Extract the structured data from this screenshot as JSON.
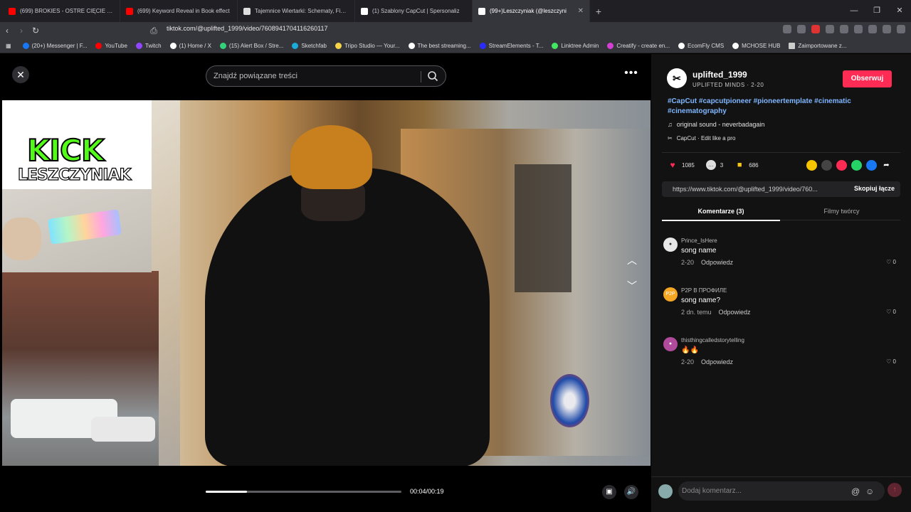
{
  "tabs": [
    {
      "label": "(699) BROKIES - OSTRE CIĘCIE - Y",
      "color": "#ff0000"
    },
    {
      "label": "(699) Keyword Reveal in Book effect",
      "color": "#ff0000"
    },
    {
      "label": "Tajemnice Wiertarki: Schematy, Fizyk",
      "color": "#ffffff"
    },
    {
      "label": "(1) Szablony CapCut | Spersonaliz",
      "color": "#ffffff"
    },
    {
      "label": "(99+)Leszczyniak (@leszczyni",
      "color": "#ffffff"
    }
  ],
  "url": "tiktok.com/@uplifted_1999/video/7608941704116260117",
  "bookmarks": [
    {
      "label": "(20+) Messenger | F...",
      "color": "#1877f2"
    },
    {
      "label": "YouTube",
      "color": "#ff0000"
    },
    {
      "label": "Twitch",
      "color": "#9146ff"
    },
    {
      "label": "(1) Home / X",
      "color": "#ffffff"
    },
    {
      "label": "(15) Alert Box / Stre...",
      "color": "#33d17a"
    },
    {
      "label": "Sketchfab",
      "color": "#1caad9"
    },
    {
      "label": "Tripo Studio — Your...",
      "color": "#f5d547"
    },
    {
      "label": "The best streaming...",
      "color": "#ffffff"
    },
    {
      "label": "StreamElements - T...",
      "color": "#2b2bff"
    },
    {
      "label": "Linktree Admin",
      "color": "#43e660"
    },
    {
      "label": "Creatify - create en...",
      "color": "#d43fd4"
    },
    {
      "label": "EcomFly CMS",
      "color": "#ffffff"
    },
    {
      "label": "MCHOSE HUB",
      "color": "#ffffff"
    },
    {
      "label": "Zaimportowane z...",
      "color": "#cccccc"
    }
  ],
  "video": {
    "search_placeholder": "Znajdź powiązane treści",
    "overlay_kick": "KICK",
    "overlay_name": "LESZCZYNIAK",
    "time": "00:04/00:19",
    "progress_fraction": 0.21
  },
  "panel": {
    "username": "uplifted_1999",
    "subline": "UPLIFTED MINDS · 2-20",
    "follow_label": "Obserwuj",
    "hashtags": "#CapCut #capcutpioneer #pioneertemplate #cinematic #cinematography",
    "music": "original sound - neverbadagain",
    "capcut": "CapCut · Edit like a pro",
    "likes": "1085",
    "comments_count": "3",
    "saves": "686",
    "link": "https://www.tiktok.com/@uplifted_1999/video/760...",
    "copy_label": "Skopiuj łącze",
    "tab_comments": "Komentarze (3)",
    "tab_creator": "Filmy twórcy",
    "comments": [
      {
        "user": "Prince_IsHere",
        "text": "song name",
        "date": "2-20",
        "reply": "Odpowiedz",
        "likes": "0",
        "avatar_color": "#e8e8e8"
      },
      {
        "user": "P2P В ПРОФИЛЕ",
        "text": "song name?",
        "date": "2 dn. temu",
        "reply": "Odpowiedz",
        "likes": "0",
        "avatar_color": "#f5a623"
      },
      {
        "user": "thisthingcalledstorytelling",
        "text": "🔥🔥",
        "date": "2-20",
        "reply": "Odpowiedz",
        "likes": "0",
        "avatar_color": "#b04a9a"
      }
    ],
    "composer_placeholder": "Dodaj komentarz..."
  }
}
